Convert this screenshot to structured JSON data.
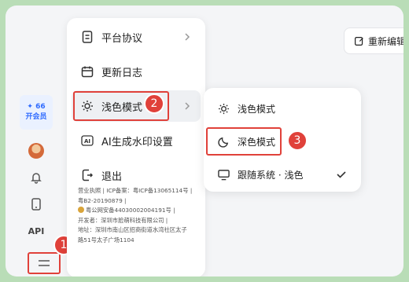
{
  "toolbar": {
    "edit_label": "重新编辑"
  },
  "rail": {
    "vip_top": "✦ 66",
    "vip_bottom": "开会员",
    "api_label": "API"
  },
  "menu": {
    "items": [
      {
        "label": "平台协议",
        "icon": "document-icon"
      },
      {
        "label": "更新日志",
        "icon": "calendar-icon"
      },
      {
        "label": "浅色模式",
        "icon": "sun-icon"
      },
      {
        "label": "AI生成水印设置",
        "icon": "ai-badge-icon"
      },
      {
        "label": "退出",
        "icon": "logout-icon"
      }
    ],
    "legal": [
      "营业执照 | ICP备案：粤ICP备13065114号 |",
      "粤B2-20190879 |",
      "粤公网安备44030002004191号 |",
      "开发者：深圳市脸萌科技有限公司 |",
      "地址：深圳市南山区招商街道水湾社区太子",
      "路51号太子广场1104"
    ]
  },
  "submenu": {
    "items": [
      {
        "label": "浅色模式",
        "icon": "sun-icon"
      },
      {
        "label": "深色模式",
        "icon": "moon-icon"
      },
      {
        "label": "跟随系统 · 浅色",
        "icon": "monitor-icon",
        "checked": true
      }
    ]
  },
  "annotations": {
    "step1": "1",
    "step2": "2",
    "step3": "3"
  },
  "colors": {
    "highlight": "#e0413a",
    "accent": "#2f6bff",
    "page_bg": "#b9ddb7"
  }
}
